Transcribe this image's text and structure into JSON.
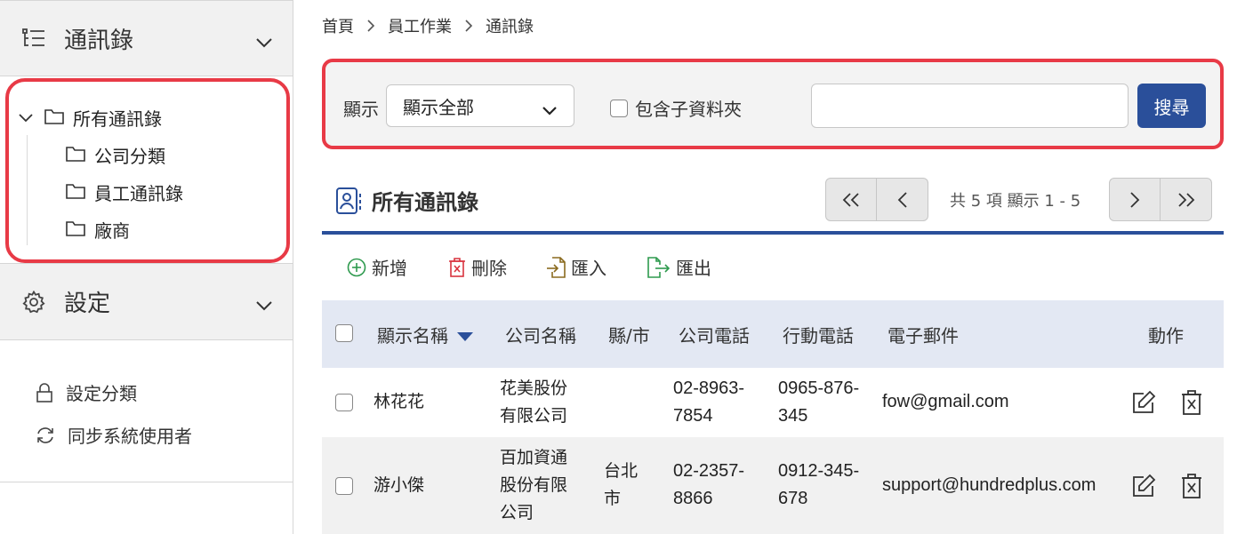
{
  "sidebar": {
    "contacts_header": "通訊錄",
    "tree": {
      "root": "所有通訊錄",
      "children": [
        "公司分類",
        "員工通訊錄",
        "廠商"
      ]
    },
    "settings_header": "設定",
    "links": [
      "設定分類",
      "同步系統使用者"
    ]
  },
  "breadcrumb": [
    "首頁",
    "員工作業",
    "通訊錄"
  ],
  "filter": {
    "label": "顯示",
    "select_value": "顯示全部",
    "include_sub_label": "包含子資料夾",
    "include_sub_checked": false,
    "search_value": "",
    "search_button": "搜尋"
  },
  "section_title": "所有通訊錄",
  "pager": {
    "info": "共 5 項 顯示 1 - 5"
  },
  "toolbar": {
    "add": "新增",
    "delete": "刪除",
    "import": "匯入",
    "export": "匯出"
  },
  "table": {
    "headers": {
      "name": "顯示名稱",
      "company": "公司名稱",
      "city": "縣/市",
      "phone": "公司電話",
      "mobile": "行動電話",
      "email": "電子郵件",
      "actions": "動作"
    },
    "rows": [
      {
        "name": "林花花",
        "company_lines": [
          "花美股份",
          "有限公司"
        ],
        "city_lines": [],
        "phone_lines": [
          "02-8963-",
          "7854"
        ],
        "mobile_lines": [
          "0965-876-",
          "345"
        ],
        "email": "fow@gmail.com"
      },
      {
        "name": "游小傑",
        "company_lines": [
          "百加資通",
          "股份有限",
          "公司"
        ],
        "city_lines": [
          "台北",
          "市"
        ],
        "phone_lines": [
          "02-2357-",
          "8866"
        ],
        "mobile_lines": [
          "0912-345-",
          "678"
        ],
        "email": "support@hundredplus.com"
      }
    ]
  },
  "colors": {
    "accent": "#2a4f9a",
    "highlight": "#e83a46",
    "header_bg": "#e3e8f3"
  }
}
